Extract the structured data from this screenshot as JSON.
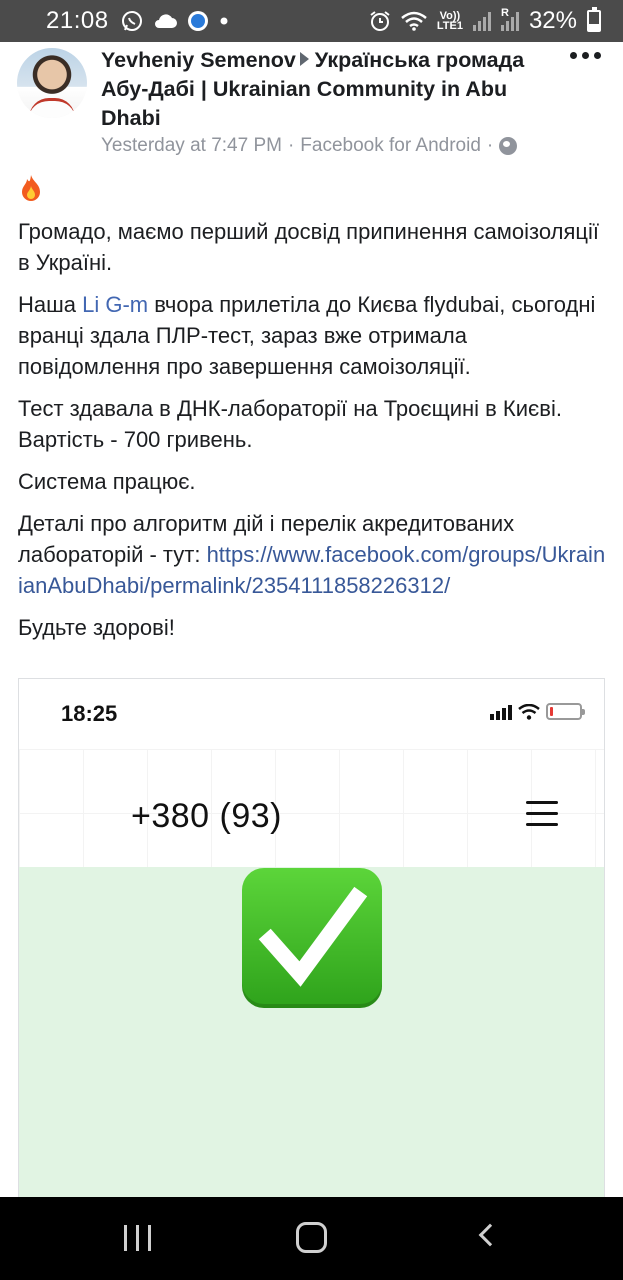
{
  "status_bar": {
    "time": "21:08",
    "battery": "32%",
    "battery_level": 0.32,
    "left_icons": [
      "whatsapp-icon",
      "cloud-icon",
      "imo-icon",
      "dot-icon"
    ],
    "right_icons": [
      "alarm-icon",
      "wifi-icon",
      "volte-icon",
      "signal-icon",
      "roaming-signal-icon",
      "battery-icon"
    ],
    "volte_label_top": "Vo))",
    "volte_label_bottom": "LTE1",
    "roaming": "R"
  },
  "post": {
    "author": "Yevheniy Semenov",
    "group": "Українська громада Абу-Дабі | Ukrainian Community in Abu Dhabi",
    "time": "Yesterday at 7:47 PM",
    "separator": "·",
    "source": "Facebook for Android",
    "paragraph1": "Громадо, маємо перший досвід припинення самоізоляції в Україні.",
    "p2_before": "Наша ",
    "p2_mention": "Li G-m",
    "p2_after": " вчора прилетіла до Києва flydubai, сьогодні вранці здала ПЛР-тест, зараз вже отримала повідомлення про завершення самоізоляції.",
    "paragraph3": "Тест здавала в ДНК-лабораторії на Троєщині в Києві. Вартість - 700 гривень.",
    "paragraph4": "Система працює.",
    "p5_text": "Деталі про алгоритм дій і перелік акредитованих лабораторій - тут:",
    "p5_link": "https://www.facebook.com/groups/UkrainianAbuDhabi/permalink/2354111858226312/",
    "paragraph6": "Будьте здорові!"
  },
  "embedded_image": {
    "time": "18:25",
    "phone": "+380 (93)",
    "battery_level": 0.1,
    "colors": {
      "green_bg": "#e1f4e3",
      "check": "#2ea21b",
      "battery_low": "#e53935"
    }
  },
  "colors": {
    "status_bar": "#4b4b4b",
    "link": "#385898",
    "meta": "#90949c",
    "navbar": "#000000"
  }
}
